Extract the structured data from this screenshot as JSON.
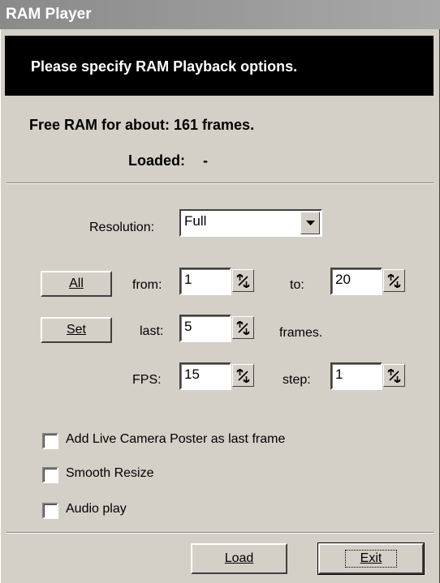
{
  "window": {
    "title": "RAM Player"
  },
  "header": {
    "text": "Please specify RAM Playback options."
  },
  "info": {
    "free_ram": "Free RAM for about: 161 frames.",
    "loaded_label": "Loaded:",
    "loaded_value": "-"
  },
  "resolution": {
    "label": "Resolution:",
    "value": "Full"
  },
  "range": {
    "all_button": "All",
    "set_button": "Set",
    "from_label": "from:",
    "from_value": "1",
    "to_label": "to:",
    "to_value": "20",
    "last_label": "last:",
    "last_value": "5",
    "frames_label": "frames.",
    "fps_label": "FPS:",
    "fps_value": "15",
    "step_label": "step:",
    "step_value": "1"
  },
  "options": [
    {
      "label": "Add Live Camera Poster as last frame",
      "checked": false
    },
    {
      "label": "Smooth Resize",
      "checked": false
    },
    {
      "label": "Audio play",
      "checked": false
    }
  ],
  "footer": {
    "load_button": "Load",
    "exit_button": "Exit"
  },
  "icons": {
    "spinner": "spinner-arrows-icon",
    "dropdown": "dropdown-arrow-icon"
  }
}
